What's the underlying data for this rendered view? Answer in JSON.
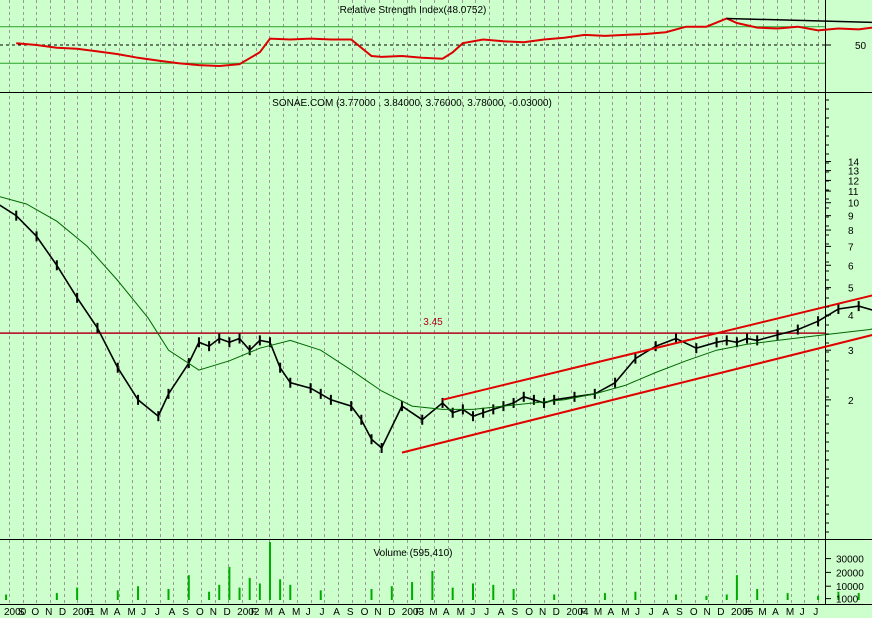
{
  "chart_data": [
    {
      "type": "line",
      "panel": "indicator",
      "title": "Relative Strength Index(48.0752)",
      "yticks": [
        "50"
      ],
      "reference_lines": [
        30,
        50,
        70
      ],
      "series": [
        {
          "name": "Relative Strength Index",
          "x": [
            2000.55,
            2000.65,
            2000.75,
            2000.85,
            2000.95,
            2001.05,
            2001.15,
            2001.25,
            2001.35,
            2001.45,
            2001.55,
            2001.65,
            2001.75,
            2001.8,
            2001.9,
            2002.0,
            2002.1,
            2002.2,
            2002.3,
            2002.35,
            2002.45,
            2002.55,
            2002.65,
            2002.7,
            2002.75,
            2002.85,
            2002.95,
            2003.05,
            2003.15,
            2003.25,
            2003.35,
            2003.45,
            2003.55,
            2003.65,
            2003.75,
            2003.85,
            2003.95,
            2004.05,
            2004.1,
            2004.2,
            2004.3,
            2004.4,
            2004.5,
            2004.6,
            2004.7,
            2004.8,
            2004.9,
            2005.0,
            2005.1,
            2005.15,
            2005.2,
            2005.25
          ],
          "values": [
            52,
            50,
            47,
            46,
            43,
            40,
            36,
            33,
            30,
            28,
            27,
            29,
            42,
            57,
            56,
            57,
            56,
            56,
            38,
            37,
            38,
            36,
            35,
            42,
            52,
            56,
            54,
            53,
            56,
            58,
            61,
            60,
            61,
            62,
            64,
            70,
            70,
            79,
            74,
            69,
            68,
            70,
            66,
            68,
            67,
            70,
            71,
            72,
            73,
            60,
            56,
            52
          ]
        }
      ]
    },
    {
      "type": "line",
      "panel": "price",
      "title": "SONAE.COM (3.77000 , 3.84000, 3.76000, 3.78000, -0.03000)",
      "scale": "log",
      "ylim": [
        1.1,
        14.5
      ],
      "yticks": [
        "14",
        "13",
        "12",
        "11",
        "10",
        "9",
        "8",
        "7",
        "6",
        "5",
        "4",
        "3",
        "2"
      ],
      "horizontal_line": {
        "value": 3.45,
        "label": "3.45",
        "color": "#b0001a"
      },
      "series": [
        {
          "name": "Close",
          "x": [
            2000.0,
            2000.1,
            2000.2,
            2000.3,
            2000.4,
            2000.45,
            2000.55,
            2000.65,
            2000.75,
            2000.85,
            2000.95,
            2001.05,
            2001.15,
            2001.25,
            2001.3,
            2001.4,
            2001.45,
            2001.5,
            2001.55,
            2001.6,
            2001.65,
            2001.7,
            2001.75,
            2001.8,
            2001.85,
            2001.9,
            2002.0,
            2002.05,
            2002.1,
            2002.2,
            2002.25,
            2002.3,
            2002.35,
            2002.45,
            2002.55,
            2002.65,
            2002.7,
            2002.75,
            2002.8,
            2002.85,
            2002.9,
            2002.95,
            2003.0,
            2003.05,
            2003.1,
            2003.15,
            2003.2,
            2003.3,
            2003.4,
            2003.5,
            2003.6,
            2003.7,
            2003.8,
            2003.9,
            2004.0,
            2004.05,
            2004.1,
            2004.15,
            2004.2,
            2004.3,
            2004.4,
            2004.5,
            2004.6,
            2004.7,
            2004.8,
            2004.9,
            2005.0,
            2005.05,
            2005.1,
            2005.15,
            2005.2,
            2005.25
          ],
          "values": [
            11.5,
            10.8,
            11.0,
            10.6,
            10.3,
            10.0,
            9.0,
            7.6,
            6.0,
            4.6,
            3.6,
            2.6,
            2.0,
            1.75,
            2.1,
            2.7,
            3.2,
            3.1,
            3.3,
            3.2,
            3.3,
            3.0,
            3.25,
            3.2,
            2.6,
            2.3,
            2.2,
            2.1,
            2.0,
            1.9,
            1.7,
            1.45,
            1.35,
            1.9,
            1.7,
            1.95,
            1.8,
            1.85,
            1.75,
            1.8,
            1.85,
            1.9,
            1.95,
            2.05,
            2.0,
            1.95,
            2.0,
            2.05,
            2.1,
            2.3,
            2.8,
            3.1,
            3.3,
            3.05,
            3.2,
            3.25,
            3.2,
            3.3,
            3.25,
            3.4,
            3.55,
            3.8,
            4.2,
            4.3,
            4.1,
            3.95,
            3.85,
            3.8,
            3.78,
            3.8,
            3.78,
            3.78
          ]
        },
        {
          "name": "Moving Average",
          "x": [
            2000.45,
            2000.6,
            2000.75,
            2000.9,
            2001.05,
            2001.2,
            2001.3,
            2001.45,
            2001.6,
            2001.75,
            2001.9,
            2002.05,
            2002.2,
            2002.35,
            2002.5,
            2002.65,
            2002.8,
            2002.95,
            2003.1,
            2003.25,
            2003.4,
            2003.55,
            2003.7,
            2003.85,
            2004.0,
            2004.15,
            2004.3,
            2004.45,
            2004.6,
            2004.75,
            2004.9,
            2005.0,
            2005.1,
            2005.2,
            2005.25
          ],
          "values": [
            10.6,
            9.9,
            8.6,
            7.0,
            5.3,
            3.9,
            3.0,
            2.55,
            2.75,
            3.05,
            3.25,
            3.0,
            2.55,
            2.15,
            1.9,
            1.85,
            1.85,
            1.9,
            1.95,
            2.0,
            2.1,
            2.25,
            2.5,
            2.75,
            3.0,
            3.15,
            3.25,
            3.35,
            3.45,
            3.55,
            3.7,
            3.8,
            3.85,
            3.85,
            3.82
          ]
        },
        {
          "name": "Upper Channel",
          "x": [
            2002.65,
            2005.5
          ],
          "values": [
            2.0,
            6.3
          ]
        },
        {
          "name": "Lower Channel",
          "x": [
            2002.45,
            2005.5
          ],
          "values": [
            1.3,
            4.6
          ]
        },
        {
          "name": "Peak Line",
          "x": [
            2004.05,
            2004.6
          ],
          "values": [
            3.4,
            3.4
          ]
        }
      ]
    },
    {
      "type": "bar",
      "panel": "volume",
      "title": "Volume (595,410)",
      "yticks": [
        "30000",
        "20000",
        "10000",
        "1000"
      ],
      "x": [
        2000.05,
        2000.1,
        2000.4,
        2000.5,
        2000.75,
        2000.85,
        2001.05,
        2001.15,
        2001.3,
        2001.4,
        2001.5,
        2001.55,
        2001.6,
        2001.65,
        2001.7,
        2001.75,
        2001.8,
        2001.85,
        2001.9,
        2002.05,
        2002.3,
        2002.4,
        2002.5,
        2002.6,
        2002.7,
        2002.8,
        2002.9,
        2003.0,
        2003.2,
        2003.45,
        2003.6,
        2003.8,
        2003.95,
        2004.05,
        2004.1,
        2004.2,
        2004.35,
        2004.5,
        2004.6,
        2004.7,
        2004.8,
        2004.9,
        2005.0,
        2005.05,
        2005.1,
        2005.15,
        2005.2
      ],
      "values": [
        15000,
        8000,
        6000,
        4000,
        5000,
        9000,
        7000,
        10000,
        8000,
        18000,
        6000,
        11000,
        24000,
        9000,
        16000,
        12000,
        42000,
        15000,
        11000,
        7000,
        8000,
        10000,
        13000,
        21000,
        9000,
        12000,
        11000,
        8000,
        4000,
        5000,
        6000,
        4000,
        3000,
        4000,
        18000,
        8000,
        5000,
        3000,
        6000,
        5000,
        8000,
        12000,
        16000,
        8000,
        5000,
        4000,
        3000
      ]
    }
  ],
  "x_axis": {
    "labels": [
      "2000",
      "S",
      "O",
      "N",
      "D",
      "2001",
      "F",
      "M",
      "A",
      "M",
      "J",
      "J",
      "A",
      "S",
      "O",
      "N",
      "D",
      "2002",
      "F",
      "M",
      "A",
      "M",
      "J",
      "J",
      "A",
      "S",
      "O",
      "N",
      "D",
      "2003",
      "F",
      "M",
      "A",
      "M",
      "J",
      "J",
      "A",
      "S",
      "O",
      "N",
      "D",
      "2004",
      "F",
      "M",
      "A",
      "M",
      "J",
      "J",
      "A",
      "S",
      "O",
      "N",
      "D",
      "2005",
      "F",
      "M",
      "A",
      "M",
      "J",
      "J"
    ]
  }
}
